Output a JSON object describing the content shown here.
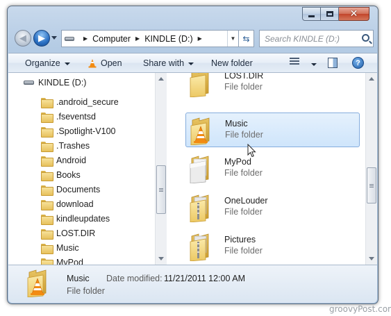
{
  "address": {
    "crumbs": [
      "Computer",
      "KINDLE (D:)"
    ]
  },
  "search": {
    "placeholder": "Search KINDLE (D:)"
  },
  "toolbar": {
    "organize": "Organize",
    "open": "Open",
    "share_with": "Share with",
    "new_folder": "New folder"
  },
  "nav_pane": {
    "drive": "KINDLE (D:)",
    "items": [
      ".android_secure",
      ".fseventsd",
      ".Spotlight-V100",
      ".Trashes",
      "Android",
      "Books",
      "Documents",
      "download",
      "kindleupdates",
      "LOST.DIR",
      "Music",
      "MyPod"
    ]
  },
  "files": [
    {
      "name": "LOST.DIR",
      "type": "File folder",
      "icon": "folder-icon"
    },
    {
      "name": "Music",
      "type": "File folder",
      "icon": "vlc-folder-icon"
    },
    {
      "name": "MyPod",
      "type": "File folder",
      "icon": "document-folder-icon"
    },
    {
      "name": "OneLouder",
      "type": "File folder",
      "icon": "zip-folder-icon"
    },
    {
      "name": "Pictures",
      "type": "File folder",
      "icon": "zip-folder-icon"
    }
  ],
  "details": {
    "name": "Music",
    "type": "File folder",
    "date_label": "Date modified:",
    "date_value": "11/21/2011 12:00 AM"
  },
  "watermark": "groovyPost.com",
  "colors": {
    "selection": "#cfe5fb",
    "selection_border": "#84acdd",
    "frame": "#b4cbe4",
    "folder": "#f2d37a",
    "vlc_cone": "#f28b12"
  }
}
